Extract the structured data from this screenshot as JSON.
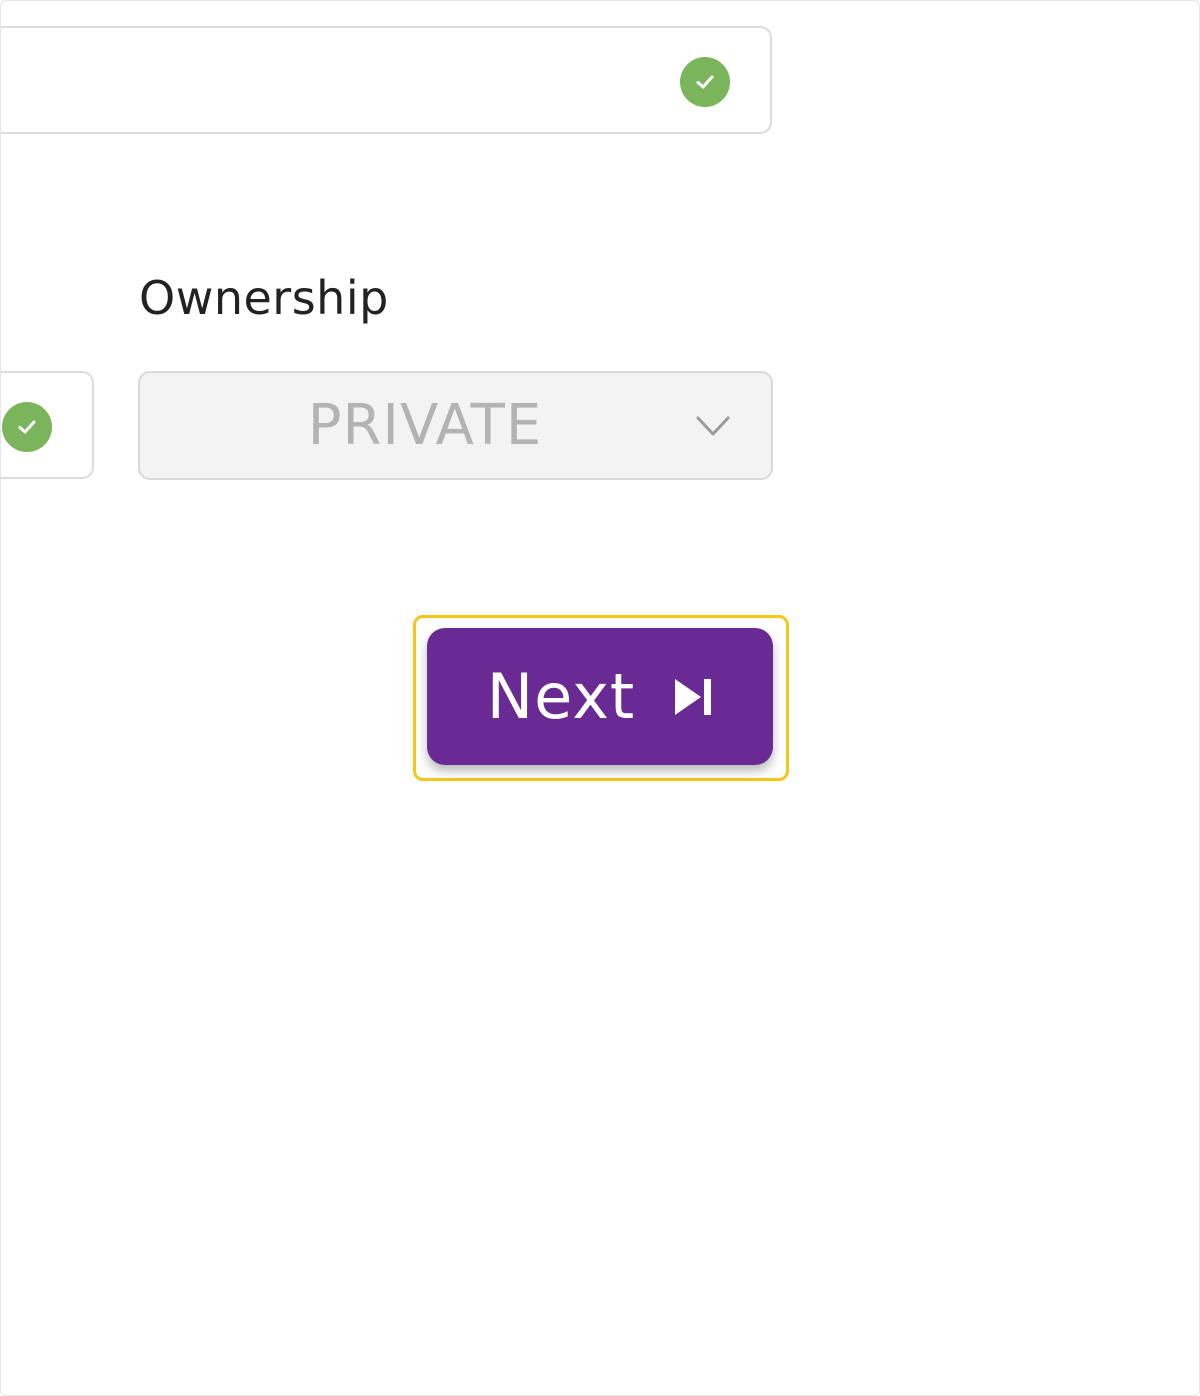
{
  "ownership": {
    "label": "Ownership",
    "selected_value": "PRIVATE"
  },
  "actions": {
    "next_label": "Next"
  },
  "icons": {
    "valid": "check-circle-icon",
    "dropdown": "chevron-down-icon",
    "next": "skip-next-icon"
  },
  "colors": {
    "accent": "#6a2a94",
    "valid": "#7ab55c",
    "highlight": "#f5c518"
  }
}
